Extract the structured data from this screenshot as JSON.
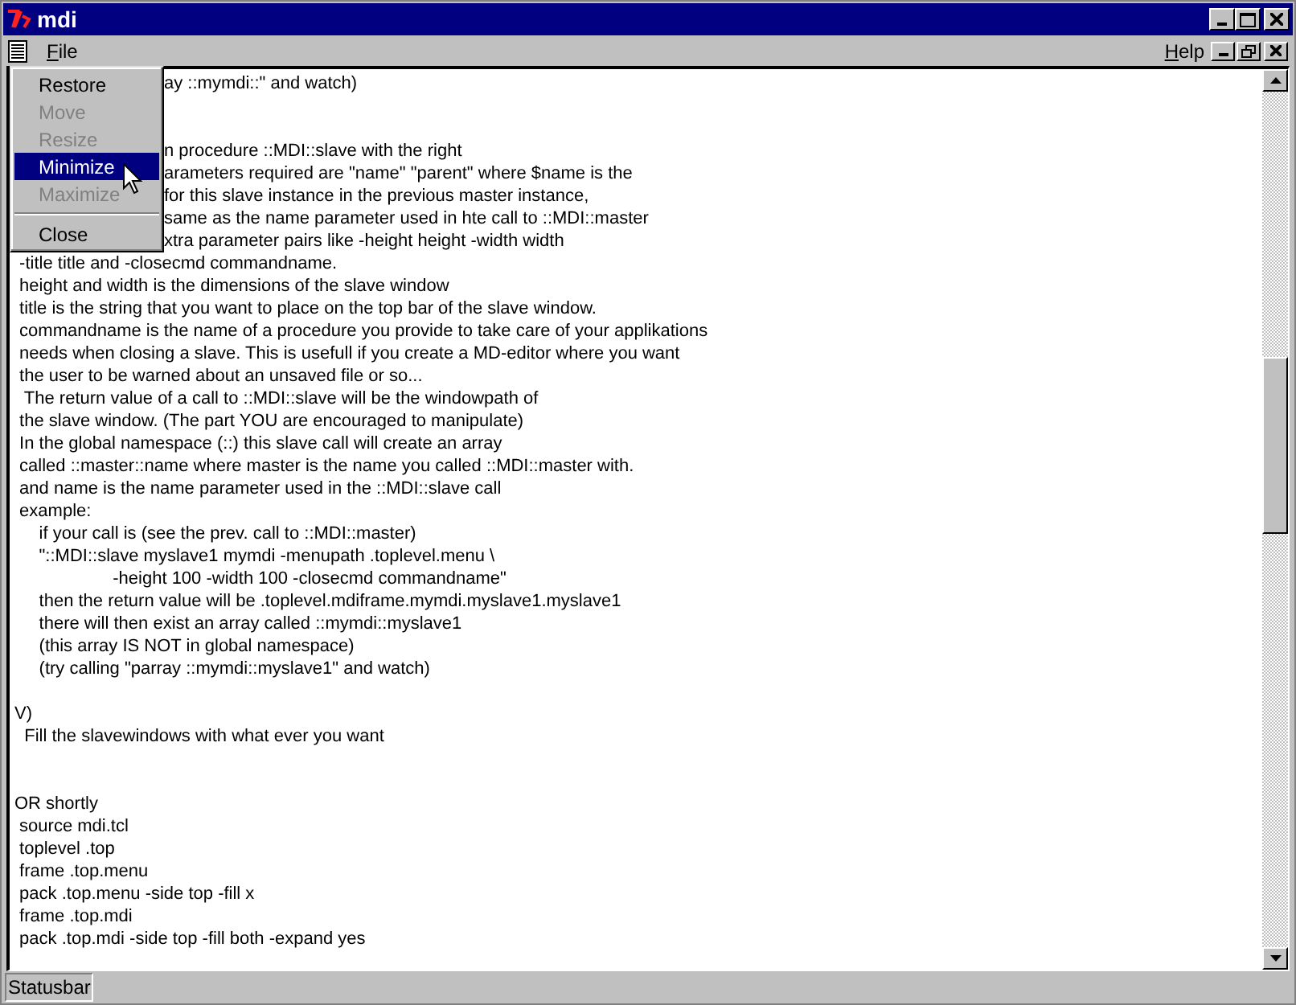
{
  "window": {
    "title": "mdi"
  },
  "menubar": {
    "items": [
      {
        "label": "File"
      },
      {
        "label": "Help"
      }
    ]
  },
  "system_menu": {
    "items": [
      {
        "label": "Restore",
        "disabled": false,
        "selected": false,
        "kind": "item"
      },
      {
        "label": "Move",
        "disabled": true,
        "selected": false,
        "kind": "item"
      },
      {
        "label": "Resize",
        "disabled": true,
        "selected": false,
        "kind": "item"
      },
      {
        "label": "Minimize",
        "disabled": false,
        "selected": true,
        "kind": "item"
      },
      {
        "label": "Maximize",
        "disabled": true,
        "selected": false,
        "kind": "item"
      },
      {
        "kind": "separator"
      },
      {
        "label": "Close",
        "disabled": false,
        "selected": false,
        "kind": "item"
      }
    ]
  },
  "text_lines": [
    {
      "kind": "partial",
      "text": "ay ::mymdi::\" and watch)"
    },
    {
      "kind": "blank"
    },
    {
      "kind": "blank"
    },
    {
      "kind": "partial",
      "text": "n procedure ::MDI::slave with the right"
    },
    {
      "kind": "partial",
      "text": "arameters required are \"name\" \"parent\" where $name is the"
    },
    {
      "kind": "partial",
      "text": "for this slave instance in the previous master instance,"
    },
    {
      "kind": "partial",
      "text": "same as the name parameter used in hte call to ::MDI::master"
    },
    {
      "kind": "partial",
      "text": "xtra parameter pairs like -height height -width width"
    },
    {
      "kind": "line",
      "text": " -title title and -closecmd commandname."
    },
    {
      "kind": "line",
      "text": " height and width is the dimensions of the slave window"
    },
    {
      "kind": "line",
      "text": " title is the string that you want to place on the top bar of the slave window."
    },
    {
      "kind": "line",
      "text": " commandname is the name of a procedure you provide to take care of your applikations"
    },
    {
      "kind": "line",
      "text": " needs when closing a slave. This is usefull if you create a MD-editor where you want"
    },
    {
      "kind": "line",
      "text": " the user to be warned about an unsaved file or so..."
    },
    {
      "kind": "line",
      "text": "  The return value of a call to ::MDI::slave will be the windowpath of"
    },
    {
      "kind": "line",
      "text": " the slave window. (The part YOU are encouraged to manipulate)"
    },
    {
      "kind": "line",
      "text": " In the global namespace (::) this slave call will create an array"
    },
    {
      "kind": "line",
      "text": " called ::master::name where master is the name you called ::MDI::master with."
    },
    {
      "kind": "line",
      "text": " and name is the name parameter used in the ::MDI::slave call"
    },
    {
      "kind": "line",
      "text": " example:"
    },
    {
      "kind": "line",
      "text": "     if your call is (see the prev. call to ::MDI::master)"
    },
    {
      "kind": "line",
      "text": "     \"::MDI::slave myslave1 mymdi -menupath .toplevel.menu \\"
    },
    {
      "kind": "line",
      "text": "                    -height 100 -width 100 -closecmd commandname\""
    },
    {
      "kind": "line",
      "text": "     then the return value will be .toplevel.mdiframe.mymdi.myslave1.myslave1"
    },
    {
      "kind": "line",
      "text": "     there will then exist an array called ::mymdi::myslave1"
    },
    {
      "kind": "line",
      "text": "     (this array IS NOT in global namespace)"
    },
    {
      "kind": "line",
      "text": "     (try calling \"parray ::mymdi::myslave1\" and watch)"
    },
    {
      "kind": "blank"
    },
    {
      "kind": "line",
      "text": "V)"
    },
    {
      "kind": "line",
      "text": "  Fill the slavewindows with what ever you want"
    },
    {
      "kind": "blank"
    },
    {
      "kind": "blank"
    },
    {
      "kind": "line",
      "text": "OR shortly"
    },
    {
      "kind": "line",
      "text": " source mdi.tcl"
    },
    {
      "kind": "line",
      "text": " toplevel .top"
    },
    {
      "kind": "line",
      "text": " frame .top.menu"
    },
    {
      "kind": "line",
      "text": " pack .top.menu -side top -fill x"
    },
    {
      "kind": "line",
      "text": " frame .top.mdi"
    },
    {
      "kind": "line",
      "text": " pack .top.mdi -side top -fill both -expand yes"
    }
  ],
  "status_bar": {
    "text": "Statusbar"
  }
}
